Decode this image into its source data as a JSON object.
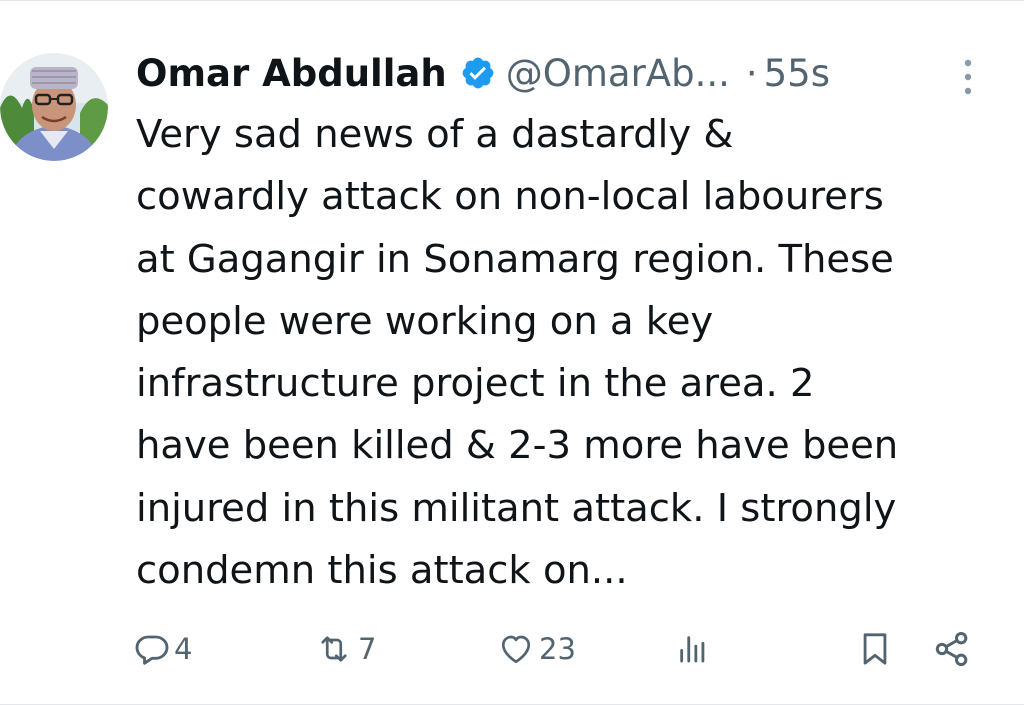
{
  "tweet": {
    "author": {
      "display_name": "Omar Abdullah",
      "handle": "@OmarAb...",
      "verified": true
    },
    "separator": "·",
    "timestamp": "55s",
    "text_lines": [
      "Very sad news of a dastardly &",
      "cowardly attack on non-local labourers",
      "at Gagangir in Sonamarg region. These",
      "people were working on a key",
      "infrastructure project in the area. 2",
      "have been killed & 2-3 more have been",
      "injured in this militant attack. I strongly",
      "condemn this attack on..."
    ],
    "actions": {
      "reply": {
        "icon": "reply-icon",
        "count": "4"
      },
      "retweet": {
        "icon": "retweet-icon",
        "count": "7"
      },
      "like": {
        "icon": "heart-icon",
        "count": "23"
      },
      "views": {
        "icon": "views-icon"
      },
      "bookmark": {
        "icon": "bookmark-icon"
      },
      "share": {
        "icon": "share-icon"
      }
    }
  },
  "colors": {
    "verified_blue": "#1d9bf0",
    "secondary_text": "#536471",
    "primary_text": "#0f1419"
  }
}
